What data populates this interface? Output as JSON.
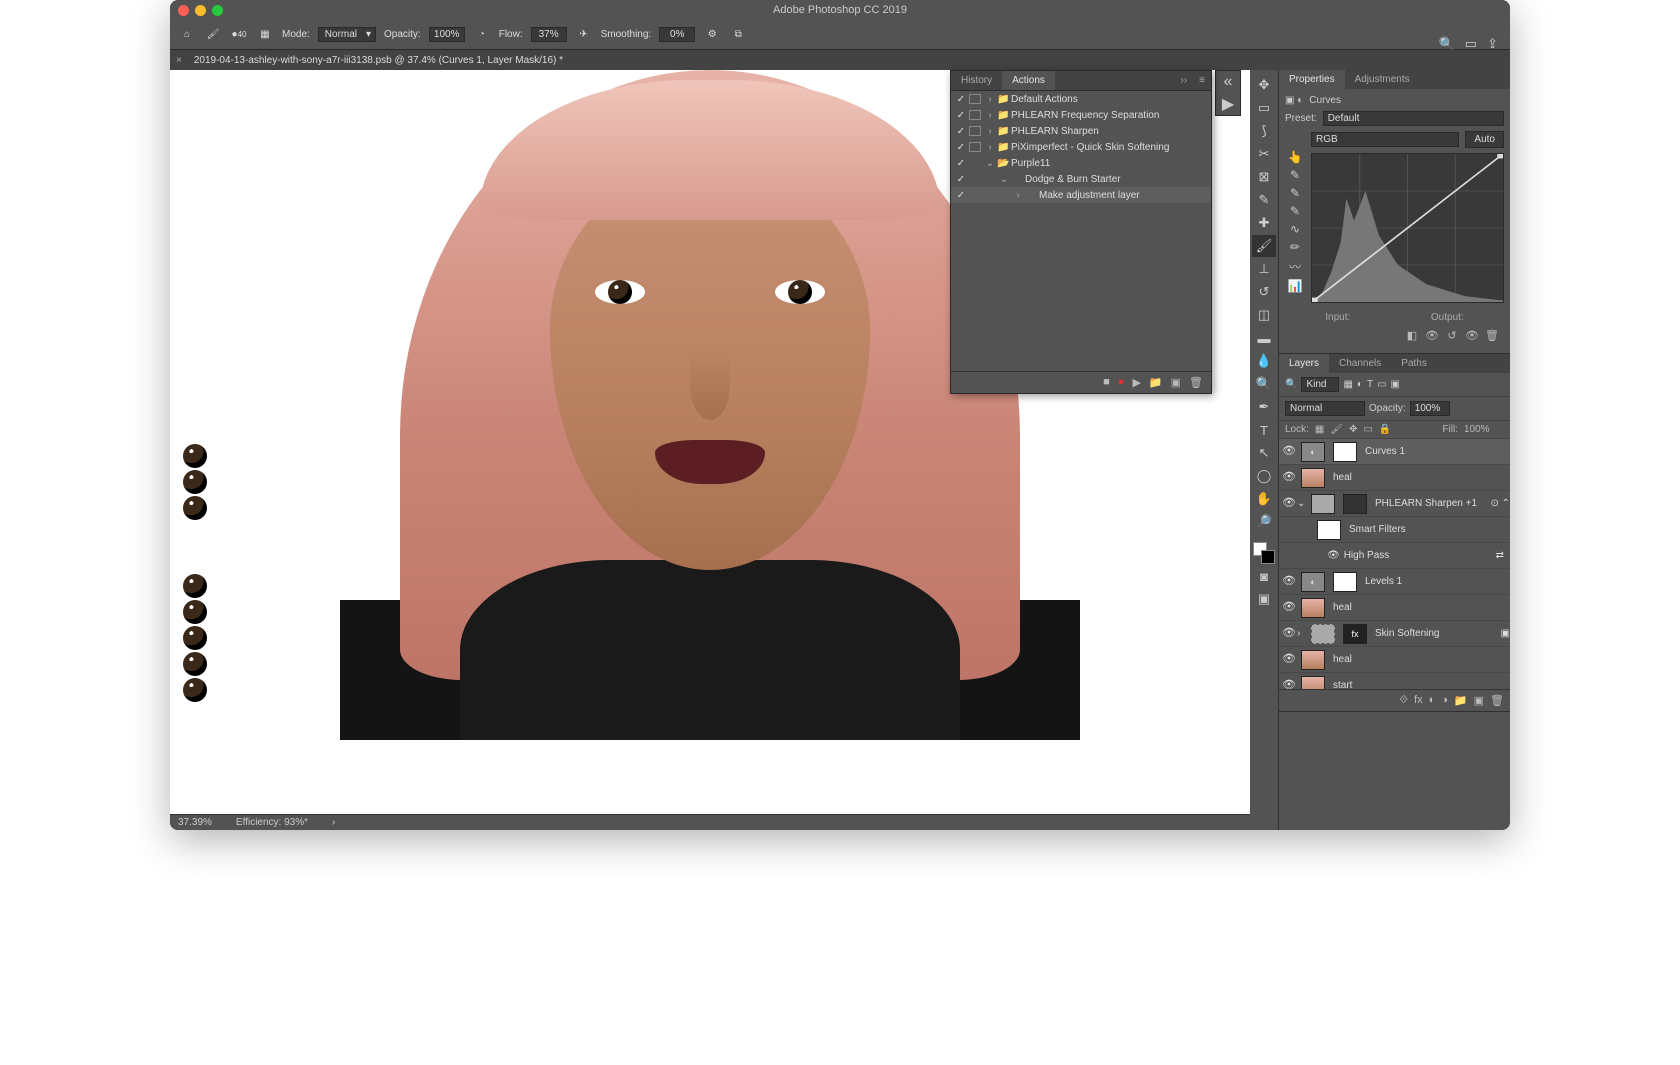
{
  "app_title": "Adobe Photoshop CC 2019",
  "doc_tab": "2019-04-13-ashley-with-sony-a7r-iii3138.psb @ 37.4% (Curves 1, Layer Mask/16) *",
  "options_bar": {
    "brush_size": "40",
    "mode_label": "Mode:",
    "mode_value": "Normal",
    "opacity_label": "Opacity:",
    "opacity_value": "100%",
    "flow_label": "Flow:",
    "flow_value": "37%",
    "smoothing_label": "Smoothing:",
    "smoothing_value": "0%"
  },
  "status": {
    "zoom": "37.39%",
    "efficiency": "Efficiency: 93%*"
  },
  "actions_panel": {
    "tabs": [
      "History",
      "Actions"
    ],
    "items": [
      {
        "checked": true,
        "dialog": true,
        "expand": "›",
        "type": "folder",
        "name": "Default Actions",
        "indent": 0
      },
      {
        "checked": true,
        "dialog": true,
        "expand": "›",
        "type": "folder",
        "name": "PHLEARN Frequency Separation",
        "indent": 0
      },
      {
        "checked": true,
        "dialog": true,
        "expand": "›",
        "type": "folder",
        "name": "PHLEARN Sharpen",
        "indent": 0
      },
      {
        "checked": true,
        "dialog": true,
        "expand": "›",
        "type": "folder",
        "name": "PiXimperfect - Quick Skin Softening",
        "indent": 0
      },
      {
        "checked": true,
        "dialog": false,
        "expand": "⌄",
        "type": "folder-open",
        "name": "Purple11",
        "indent": 0
      },
      {
        "checked": true,
        "dialog": false,
        "expand": "⌄",
        "type": "",
        "name": "Dodge & Burn Starter",
        "indent": 1
      },
      {
        "checked": true,
        "dialog": false,
        "expand": "›",
        "type": "",
        "name": "Make adjustment layer",
        "indent": 2,
        "sel": true
      }
    ]
  },
  "properties_panel": {
    "tabs": [
      "Properties",
      "Adjustments"
    ],
    "type_label": "Curves",
    "preset_label": "Preset:",
    "preset_value": "Default",
    "channel_value": "RGB",
    "auto_label": "Auto",
    "input_label": "Input:",
    "output_label": "Output:"
  },
  "layers_panel": {
    "tabs": [
      "Layers",
      "Channels",
      "Paths"
    ],
    "kind_label": "Kind",
    "blend_mode": "Normal",
    "opacity_label": "Opacity:",
    "opacity_value": "100%",
    "lock_label": "Lock:",
    "fill_label": "Fill:",
    "fill_value": "100%",
    "layers": [
      {
        "name": "Curves 1",
        "adj": true,
        "mask": true,
        "sel": true,
        "indent": 0
      },
      {
        "name": "heal",
        "thumb": "photo",
        "indent": 0
      },
      {
        "name": "PHLEARN Sharpen +1",
        "smart": true,
        "indent": 0,
        "expand": "⌄"
      },
      {
        "name": "Smart Filters",
        "indent": 1,
        "fx": true
      },
      {
        "name": "High Pass",
        "indent": 2,
        "filter": true,
        "eye": true
      },
      {
        "name": "Levels 1",
        "adj": true,
        "mask": true,
        "indent": 0
      },
      {
        "name": "heal",
        "thumb": "photo",
        "indent": 0
      },
      {
        "name": "Skin Softening",
        "group": true,
        "indent": 0,
        "expand": "›"
      },
      {
        "name": "heal",
        "thumb": "photo",
        "indent": 0
      },
      {
        "name": "start",
        "thumb": "photo",
        "indent": 0
      }
    ]
  }
}
